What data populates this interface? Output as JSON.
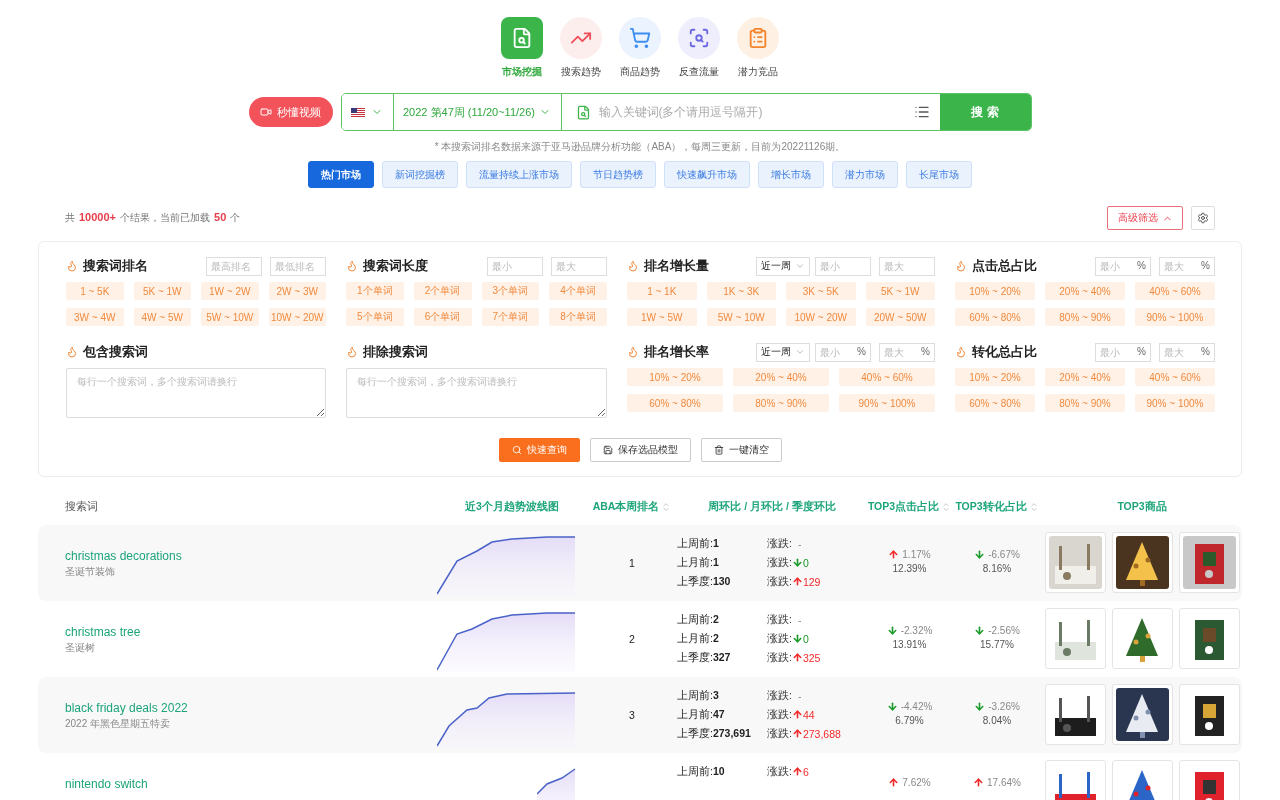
{
  "nav": [
    {
      "label": "市场挖掘",
      "selected": true,
      "kind": "market"
    },
    {
      "label": "搜索趋势",
      "selected": false,
      "kind": "trend"
    },
    {
      "label": "商品趋势",
      "selected": false,
      "kind": "goods"
    },
    {
      "label": "反查流量",
      "selected": false,
      "kind": "reverse"
    },
    {
      "label": "潜力竞品",
      "selected": false,
      "kind": "potential"
    }
  ],
  "video_button": "秒懂视频",
  "search": {
    "week": "2022 第47周 (11/20~11/26)",
    "placeholder": "输入关键词(多个请用逗号隔开)",
    "button": "搜 索"
  },
  "note": "* 本搜索词排名数据来源于亚马逊品牌分析功能（ABA），每周三更新，目前为20221126期。",
  "market_tabs": [
    {
      "label": "热门市场",
      "selected": true
    },
    {
      "label": "新词挖掘榜",
      "selected": false
    },
    {
      "label": "流量持续上涨市场",
      "selected": false
    },
    {
      "label": "节日趋势榜",
      "selected": false
    },
    {
      "label": "快速飙升市场",
      "selected": false
    },
    {
      "label": "增长市场",
      "selected": false
    },
    {
      "label": "潜力市场",
      "selected": false
    },
    {
      "label": "长尾市场",
      "selected": false
    }
  ],
  "summary": {
    "prefix": "共",
    "total": "10000+",
    "middle": "个结果，当前已加载",
    "loaded": "50",
    "suffix": "个"
  },
  "advanced_button": {
    "label": "高级筛选",
    "expanded": true
  },
  "filters": [
    {
      "title": "搜索词排名",
      "kind": "chips",
      "inputs": [
        {
          "placeholder": "最高排名"
        },
        {
          "placeholder": "最低排名"
        }
      ],
      "chips": [
        "1 ~ 5K",
        "5K ~ 1W",
        "1W ~ 2W",
        "2W ~ 3W",
        "3W ~ 4W",
        "4W ~ 5W",
        "5W ~ 10W",
        "10W ~ 20W"
      ]
    },
    {
      "title": "搜索词长度",
      "kind": "chips",
      "inputs": [
        {
          "placeholder": "最小"
        },
        {
          "placeholder": "最大"
        }
      ],
      "chips": [
        "1个单词",
        "2个单词",
        "3个单词",
        "4个单词",
        "5个单词",
        "6个单词",
        "7个单词",
        "8个单词"
      ]
    },
    {
      "title": "排名增长量",
      "kind": "chips",
      "period": "近一周",
      "inputs": [
        {
          "placeholder": "最小"
        },
        {
          "placeholder": "最大"
        }
      ],
      "chips": [
        "1 ~ 1K",
        "1K ~ 3K",
        "3K ~ 5K",
        "5K ~ 1W",
        "1W ~ 5W",
        "5W ~ 10W",
        "10W ~ 20W",
        "20W ~ 50W"
      ]
    },
    {
      "title": "点击总占比",
      "kind": "chips",
      "inputs": [
        {
          "placeholder": "最小",
          "unit": "%"
        },
        {
          "placeholder": "最大",
          "unit": "%"
        }
      ],
      "chips": [
        "10% ~ 20%",
        "20% ~ 40%",
        "40% ~ 60%",
        "60% ~ 80%",
        "80% ~ 90%",
        "90% ~ 100%"
      ]
    },
    {
      "title": "包含搜索词",
      "kind": "textarea",
      "placeholder": "每行一个搜索词，多个搜索词请换行"
    },
    {
      "title": "排除搜索词",
      "kind": "textarea",
      "placeholder": "每行一个搜索词，多个搜索词请换行"
    },
    {
      "title": "排名增长率",
      "kind": "chips",
      "period": "近一周",
      "inputs": [
        {
          "placeholder": "最小",
          "unit": "%"
        },
        {
          "placeholder": "最大",
          "unit": "%"
        }
      ],
      "chips": [
        "10% ~ 20%",
        "20% ~ 40%",
        "40% ~ 60%",
        "60% ~ 80%",
        "80% ~ 90%",
        "90% ~ 100%"
      ]
    },
    {
      "title": "转化总占比",
      "kind": "chips",
      "inputs": [
        {
          "placeholder": "最小",
          "unit": "%"
        },
        {
          "placeholder": "最大",
          "unit": "%"
        }
      ],
      "chips": [
        "10% ~ 20%",
        "20% ~ 40%",
        "40% ~ 60%",
        "60% ~ 80%",
        "80% ~ 90%",
        "90% ~ 100%"
      ]
    }
  ],
  "actions": [
    {
      "label": "快速查询",
      "kind": "primary"
    },
    {
      "label": "保存选品模型",
      "kind": "save"
    },
    {
      "label": "一键清空",
      "kind": "clear"
    }
  ],
  "table": {
    "columns": [
      {
        "label": "搜索词",
        "sortable": false,
        "kind": "plain"
      },
      {
        "label": "近3个月趋势波线图",
        "sortable": false,
        "kind": "accent"
      },
      {
        "label": "ABA本周排名",
        "sortable": true,
        "kind": "accent"
      },
      {
        "label": "周环比 / 月环比 / 季度环比",
        "sortable": false,
        "kind": "accent"
      },
      {
        "label": "TOP3点击占比",
        "sortable": true,
        "kind": "accent"
      },
      {
        "label": "TOP3转化占比",
        "sortable": true,
        "kind": "accent"
      },
      {
        "label": "TOP3商品",
        "sortable": false,
        "kind": "accent"
      }
    ],
    "rows": [
      {
        "keyword": "christmas decorations",
        "translation": "圣诞节装饰",
        "rank": "1",
        "history": [
          {
            "label": "上周前:",
            "value": "1",
            "change_label": "涨跌:",
            "change": "-",
            "kind": "none"
          },
          {
            "label": "上月前:",
            "value": "1",
            "change_label": "涨跌:",
            "change": "0",
            "kind": "down"
          },
          {
            "label": "上季度:",
            "value": "130",
            "change_label": "涨跌:",
            "change": "129",
            "kind": "up"
          }
        ],
        "click": {
          "kind": "up",
          "change": "1.17%",
          "value": "12.39%"
        },
        "conversion": {
          "kind": "down",
          "change": "-6.67%",
          "value": "8.16%"
        },
        "products": [
          {
            "kind": "picture"
          },
          {
            "kind": "picture"
          },
          {
            "kind": "picture"
          }
        ]
      },
      {
        "keyword": "christmas tree",
        "translation": "圣诞树",
        "rank": "2",
        "history": [
          {
            "label": "上周前:",
            "value": "2",
            "change_label": "涨跌:",
            "change": "-",
            "kind": "none"
          },
          {
            "label": "上月前:",
            "value": "2",
            "change_label": "涨跌:",
            "change": "0",
            "kind": "down"
          },
          {
            "label": "上季度:",
            "value": "327",
            "change_label": "涨跌:",
            "change": "325",
            "kind": "up"
          }
        ],
        "click": {
          "kind": "down",
          "change": "-2.32%",
          "value": "13.91%"
        },
        "conversion": {
          "kind": "down",
          "change": "-2.56%",
          "value": "15.77%"
        },
        "products": [
          {
            "kind": "picture"
          },
          {
            "kind": "picture"
          },
          {
            "kind": "picture"
          }
        ]
      },
      {
        "keyword": "black friday deals 2022",
        "translation": "2022 年黑色星期五特卖",
        "rank": "3",
        "history": [
          {
            "label": "上周前:",
            "value": "3",
            "change_label": "涨跌:",
            "change": "-",
            "kind": "none"
          },
          {
            "label": "上月前:",
            "value": "47",
            "change_label": "涨跌:",
            "change": "44",
            "kind": "up"
          },
          {
            "label": "上季度:",
            "value": "273,691",
            "change_label": "涨跌:",
            "change": "273,688",
            "kind": "up"
          }
        ],
        "click": {
          "kind": "down",
          "change": "-4.42%",
          "value": "6.79%"
        },
        "conversion": {
          "kind": "down",
          "change": "-3.26%",
          "value": "8.04%"
        },
        "products": [
          {
            "kind": "picture"
          },
          {
            "kind": "picture"
          },
          {
            "kind": "picture"
          }
        ]
      },
      {
        "keyword": "nintendo switch",
        "history": [
          {
            "label": "上周前:",
            "value": "10",
            "change_label": "涨跌:",
            "change": "6",
            "kind": "up"
          }
        ],
        "click": {
          "kind": "up",
          "change": "7.62%"
        },
        "conversion": {
          "kind": "up",
          "change": "17.64%"
        },
        "products": [
          {
            "kind": "picture"
          },
          {
            "kind": "picture"
          },
          {
            "kind": "picture"
          }
        ]
      }
    ]
  }
}
